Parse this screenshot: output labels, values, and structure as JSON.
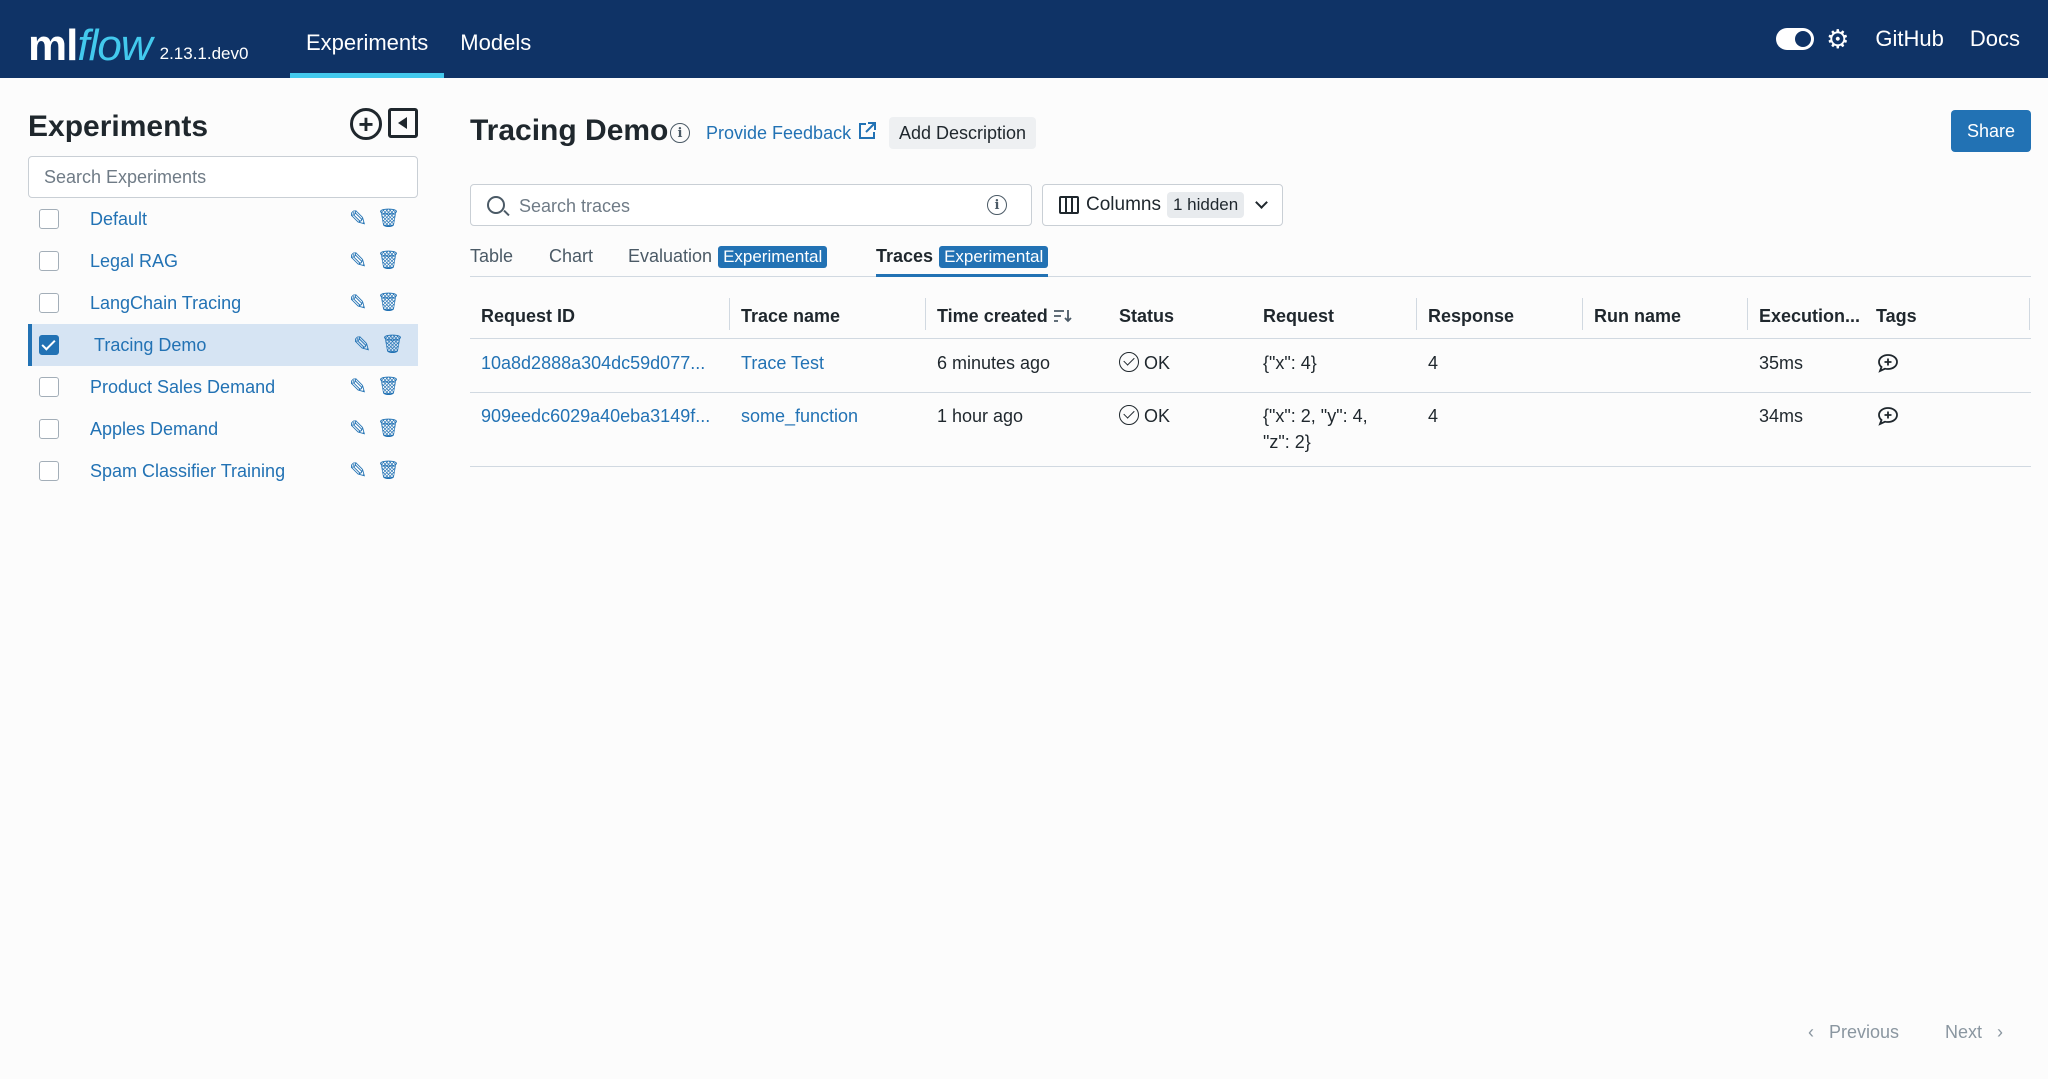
{
  "header": {
    "logo_ml": "ml",
    "logo_flow": "flow",
    "version": "2.13.1.dev0",
    "nav": [
      "Experiments",
      "Models"
    ],
    "links": [
      "GitHub",
      "Docs"
    ],
    "icons": [
      "theme-toggle",
      "gear-icon"
    ]
  },
  "sidebar": {
    "title": "Experiments",
    "search_placeholder": "Search Experiments",
    "items": [
      {
        "name": "Default",
        "selected": false
      },
      {
        "name": "Legal RAG",
        "selected": false
      },
      {
        "name": "LangChain Tracing",
        "selected": false
      },
      {
        "name": "Tracing Demo",
        "selected": true
      },
      {
        "name": "Product Sales Demand",
        "selected": false
      },
      {
        "name": "Apples Demand",
        "selected": false
      },
      {
        "name": "Spam Classifier Training",
        "selected": false
      }
    ]
  },
  "main": {
    "title": "Tracing Demo",
    "feedback": "Provide Feedback",
    "add_description": "Add Description",
    "share": "Share",
    "search_placeholder": "Search traces",
    "columns_label": "Columns",
    "columns_badge": "1 hidden",
    "tabs": {
      "table": "Table",
      "chart": "Chart",
      "evaluation": "Evaluation",
      "traces": "Traces",
      "badge": "Experimental",
      "active": "Traces"
    },
    "columns": [
      "Request ID",
      "Trace name",
      "Time created",
      "Status",
      "Request",
      "Response",
      "Run name",
      "Execution...",
      "Tags"
    ],
    "rows": [
      {
        "request_id": "10a8d2888a304dc59d077...",
        "trace_name": "Trace Test",
        "time": "6 minutes ago",
        "status": "OK",
        "request_1": "{\"x\": 4}",
        "request_2": "",
        "response": "4",
        "run_name": "",
        "execution": "35ms"
      },
      {
        "request_id": "909eedc6029a40eba3149f...",
        "trace_name": "some_function",
        "time": "1 hour ago",
        "status": "OK",
        "request_1": "{\"x\": 2, \"y\": 4,",
        "request_2": "\"z\": 2}",
        "response": "4",
        "run_name": "",
        "execution": "34ms"
      }
    ]
  },
  "pager": {
    "previous": "Previous",
    "next": "Next"
  }
}
